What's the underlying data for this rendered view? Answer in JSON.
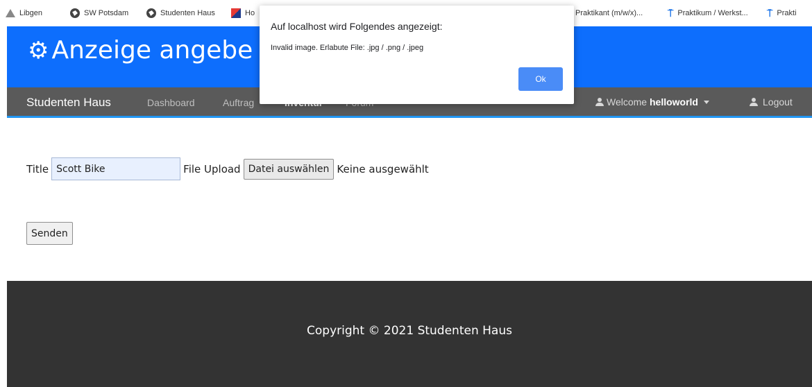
{
  "bookmarks": [
    {
      "label": "Libgen",
      "icon": "warning-triangle-icon"
    },
    {
      "label": "SW Potsdam",
      "icon": "globe-icon"
    },
    {
      "label": "Studenten Haus",
      "icon": "globe-icon"
    },
    {
      "label": "Ho",
      "icon": "flag-icon"
    },
    {
      "label": "Praktikant (m/w/x)...",
      "icon": "none"
    },
    {
      "label": "Praktikum / Werkst...",
      "icon": "pin-icon"
    },
    {
      "label": "Prakti",
      "icon": "pin-icon"
    }
  ],
  "header": {
    "title": "Anzeige angebe",
    "icon": "gear-icon"
  },
  "nav": {
    "brand": "Studenten Haus",
    "links": [
      "Dashboard",
      "Auftrag",
      "Inventur",
      "Forum"
    ],
    "welcome_prefix": "Welcome ",
    "username": "helloworld",
    "logout": "Logout"
  },
  "form": {
    "title_label": "Title",
    "title_value": "Scott Bike",
    "file_label": "File Upload",
    "file_button": "Datei auswählen",
    "file_status": "Keine ausgewählt",
    "submit": "Senden"
  },
  "footer": {
    "text": "Copyright © 2021 Studenten Haus"
  },
  "dialog": {
    "title": "Auf localhost wird Folgendes angezeigt:",
    "message": "Invalid image. Erlabute File: .jpg / .png / .jpeg",
    "ok": "Ok"
  },
  "colors": {
    "header_blue": "#0d6efd",
    "navbar_gray": "#5a5a5a",
    "footer_dark": "#333333",
    "ok_blue": "#4a8cf7"
  }
}
